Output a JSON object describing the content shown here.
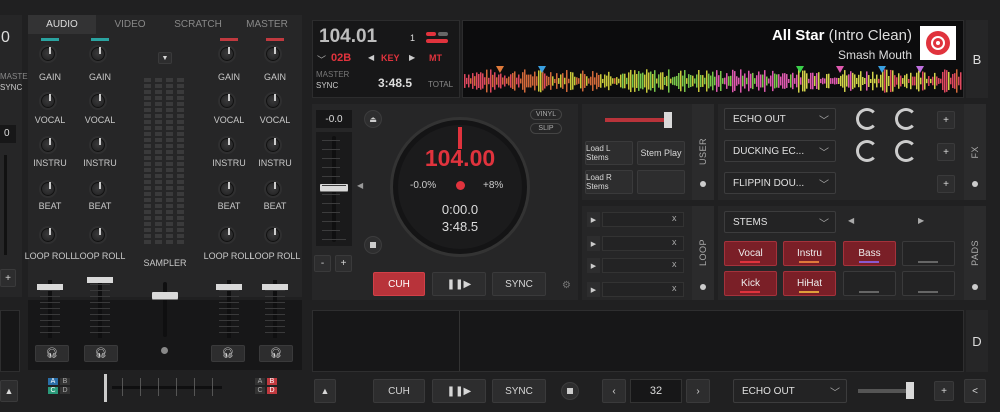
{
  "mixer_tabs": [
    "AUDIO",
    "VIDEO",
    "SCRATCH",
    "MASTER"
  ],
  "left_edge": {
    "value_top": "0",
    "label_master": "MASTER",
    "label_sync": "SYNC",
    "value_mid": "0"
  },
  "channel_labels": {
    "gain": "GAIN",
    "vocal": "VOCAL",
    "instru": "INSTRU",
    "beat": "BEAT",
    "loop_roll": "LOOP ROLL"
  },
  "sampler_label": "SAMPLER",
  "deck_bottom_letters": {
    "a": "A",
    "b": "B",
    "c": "C",
    "d": "D"
  },
  "deck_b": {
    "letter": "B",
    "bpm": "104.01",
    "key_number": "1",
    "key_code": "02B",
    "key_label": "KEY",
    "mt_label": "MT",
    "master_label": "MASTER",
    "sync_label": "SYNC",
    "total_time": "3:48.5",
    "total_label": "TOTAL",
    "title": "All Star",
    "title_suffix": "(Intro Clean)",
    "artist": "Smash Mouth",
    "pitch_value": "-0.0",
    "vinyl_label": "VINYL",
    "slip_label": "SLIP",
    "jog_bpm": "104.00",
    "pitch_min": "-0.0%",
    "pitch_max": "+8%",
    "elapsed": "0:00.0",
    "remaining": "3:48.5",
    "cue_label": "CUH",
    "sync_btn": "SYNC",
    "colors": {
      "accent": "#e0333d",
      "waveform_bg": "#0c0c0d"
    }
  },
  "user_panel": {
    "tab": "USER",
    "load_l_stems": "Load L Stems",
    "stem_play": "Stem Play",
    "load_r_stems": "Load R Stems"
  },
  "fx_panel": {
    "tab": "FX",
    "slots": [
      "ECHO OUT",
      "DUCKING EC...",
      "FLIPPIN DOU..."
    ],
    "plus": "+"
  },
  "loop_panel": {
    "tab": "LOOP",
    "close": "x"
  },
  "pads_panel": {
    "tab": "PADS",
    "mode": "STEMS",
    "pads": [
      "Vocal",
      "Instru",
      "Bass",
      "",
      "Kick",
      "HiHat",
      "",
      ""
    ]
  },
  "deck_d": {
    "letter": "D",
    "cue_label": "CUH",
    "sync_btn": "SYNC",
    "loop_size": "32",
    "fx_select": "ECHO OUT",
    "plus": "+",
    "collapse": "<"
  }
}
